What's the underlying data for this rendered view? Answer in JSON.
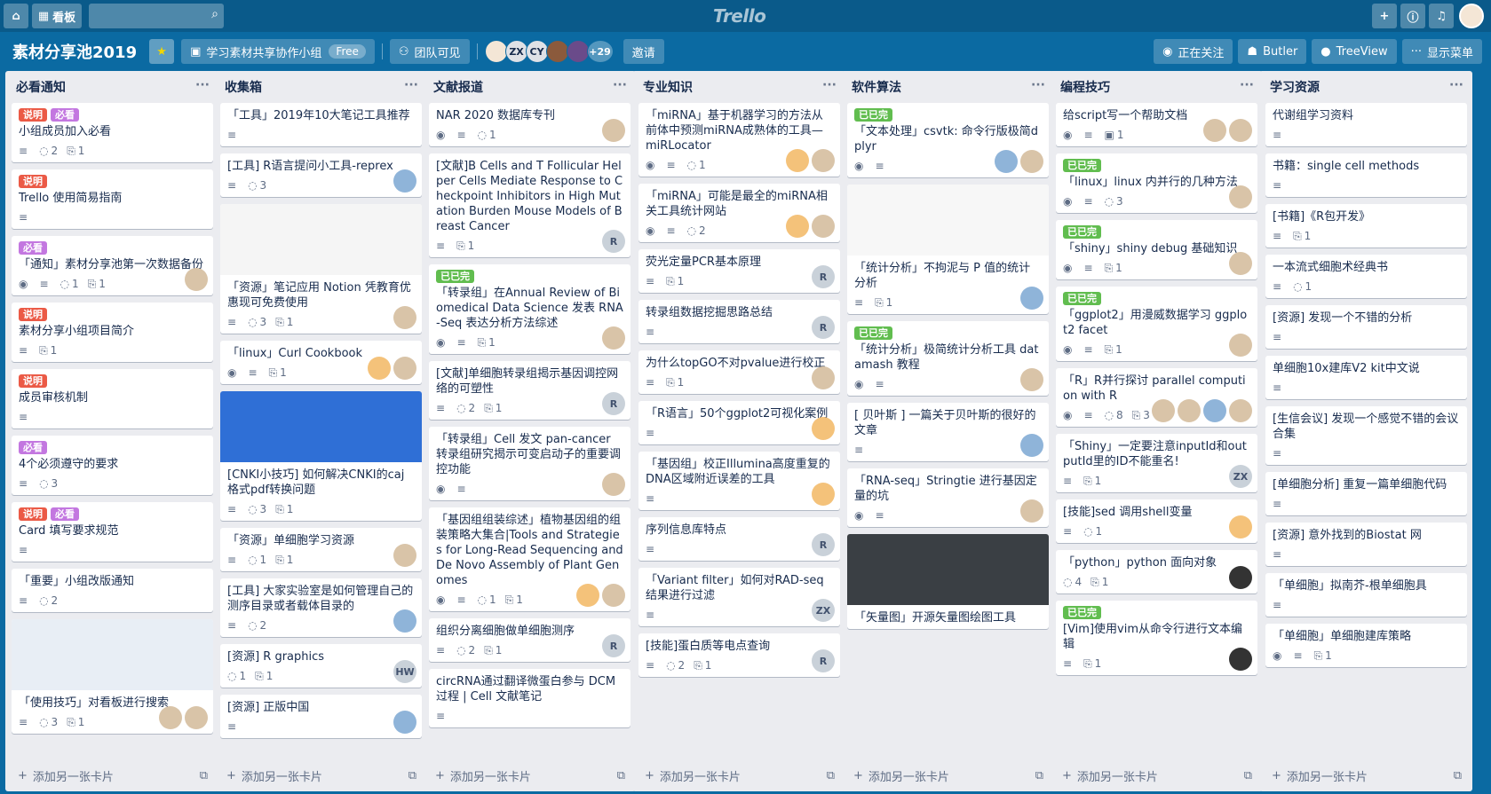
{
  "topbar": {
    "board_btn": "看板",
    "logo": "Trello",
    "search_placeholder": ""
  },
  "board": {
    "title": "素材分享池2019",
    "team": "学习素材共享协作小组",
    "team_badge": "Free",
    "visibility": "团队可见",
    "members": [
      "ZX",
      "CY"
    ],
    "members_more": "+29",
    "invite": "邀请",
    "watch": "正在关注",
    "butler": "Butler",
    "treeview": "TreeView",
    "show_menu": "显示菜单"
  },
  "add_card_label": "添加另一张卡片",
  "lists": [
    {
      "title": "必看通知",
      "cards": [
        {
          "labels": [
            {
              "t": "说明",
              "c": "red"
            },
            {
              "t": "必看",
              "c": "purple"
            }
          ],
          "title": "小组成员加入必看",
          "badges": [
            "desc",
            "c:2",
            "a:1"
          ]
        },
        {
          "labels": [
            {
              "t": "说明",
              "c": "red"
            }
          ],
          "title": "Trello 使用简易指南",
          "badges": [
            "desc"
          ]
        },
        {
          "labels": [
            {
              "t": "必看",
              "c": "purple"
            }
          ],
          "title": "「通知」素材分享池第一次数据备份",
          "badges": [
            "eye",
            "desc",
            "c:1",
            "a:1"
          ],
          "avs": [
            "face"
          ]
        },
        {
          "labels": [
            {
              "t": "说明",
              "c": "red"
            }
          ],
          "title": "素材分享小组项目简介",
          "badges": [
            "desc",
            "a:1"
          ]
        },
        {
          "labels": [
            {
              "t": "说明",
              "c": "red"
            }
          ],
          "title": "成员审核机制",
          "badges": [
            "desc"
          ]
        },
        {
          "labels": [
            {
              "t": "必看",
              "c": "purple"
            }
          ],
          "title": "4个必须遵守的要求",
          "badges": [
            "desc",
            "c:3"
          ]
        },
        {
          "labels": [
            {
              "t": "说明",
              "c": "red"
            },
            {
              "t": "必看",
              "c": "purple"
            }
          ],
          "title": "Card 填写要求规范",
          "badges": [
            "desc"
          ]
        },
        {
          "title": "「重要」小组改版通知",
          "badges": [
            "desc",
            "c:2"
          ]
        },
        {
          "cover": "#e8eef5",
          "title": "「使用技巧」对看板进行搜索",
          "badges": [
            "desc",
            "c:3",
            "a:1"
          ],
          "avs": [
            "face",
            "face"
          ]
        }
      ]
    },
    {
      "title": "收集箱",
      "cards": [
        {
          "title": "「工具」2019年10大笔记工具推荐",
          "badges": [
            "desc"
          ]
        },
        {
          "title": "[工具] R语言提问小工具-reprex",
          "badges": [
            "desc",
            "c:3"
          ],
          "avs": [
            "blue"
          ]
        },
        {
          "cover": "#f5f5f5",
          "title": "「资源」笔记应用 Notion 凭教育优惠现可免费使用",
          "badges": [
            "desc",
            "c:3",
            "a:1"
          ],
          "avs": [
            "face"
          ]
        },
        {
          "title": "「linux」Curl Cookbook",
          "badges": [
            "eye",
            "desc",
            "a:1"
          ],
          "avs": [
            "orange",
            "face"
          ]
        },
        {
          "cover": "#2f6fd6",
          "title": "[CNKI小技巧] 如何解决CNKI的caj格式pdf转换问题",
          "badges": [
            "desc",
            "c:3",
            "a:1"
          ]
        },
        {
          "title": "「资源」单细胞学习资源",
          "badges": [
            "desc",
            "c:1",
            "a:1"
          ],
          "avs": [
            "face"
          ]
        },
        {
          "title": "[工具] 大家实验室是如何管理自己的测序目录或者载体目录的",
          "badges": [
            "desc",
            "c:2"
          ],
          "avs": [
            "blue"
          ]
        },
        {
          "title": "[资源] R graphics",
          "badges": [
            "c:1",
            "a:1"
          ],
          "avs": [
            "HW"
          ]
        },
        {
          "title": "[资源] 正版中国",
          "badges": [
            "desc"
          ],
          "avs": [
            "blue"
          ]
        }
      ]
    },
    {
      "title": "文献报道",
      "cards": [
        {
          "title": "NAR 2020 数据库专刊",
          "badges": [
            "eye",
            "desc",
            "c:1"
          ],
          "avs": [
            "face"
          ]
        },
        {
          "title": "[文献]B Cells and T Follicular Helper Cells Mediate Response to Checkpoint Inhibitors in High Mutation Burden Mouse Models of Breast Cancer",
          "badges": [
            "desc",
            "a:1"
          ],
          "avs": [
            "R"
          ]
        },
        {
          "labels": [
            {
              "t": "已已完",
              "c": "green"
            }
          ],
          "title": "「转录组」在Annual Review of Biomedical Data Science 发表 RNA-Seq 表达分析方法综述",
          "badges": [
            "eye",
            "desc",
            "a:1"
          ],
          "avs": [
            "face"
          ]
        },
        {
          "title": "[文献]单细胞转录组揭示基因调控网络的可塑性",
          "badges": [
            "desc",
            "c:2",
            "a:1"
          ],
          "avs": [
            "R"
          ]
        },
        {
          "title": "「转录组」Cell 发文 pan-cancer 转录组研究揭示可变启动子的重要调控功能",
          "badges": [
            "eye",
            "desc"
          ],
          "avs": [
            "face"
          ]
        },
        {
          "title": "「基因组组装综述」植物基因组的组装策略大集合|Tools and Strategies for Long-Read Sequencing and De Novo Assembly of Plant Genomes",
          "badges": [
            "eye",
            "desc",
            "c:1",
            "a:1"
          ],
          "avs": [
            "orange",
            "face"
          ]
        },
        {
          "title": "组织分离细胞做单细胞测序",
          "badges": [
            "desc",
            "c:2",
            "a:1"
          ],
          "avs": [
            "R"
          ]
        },
        {
          "title": "circRNA通过翻译微蛋白参与 DCM过程 | Cell 文献笔记",
          "badges": [
            "desc"
          ]
        }
      ]
    },
    {
      "title": "专业知识",
      "cards": [
        {
          "title": "「miRNA」基于机器学习的方法从前体中预测miRNA成熟体的工具—miRLocator",
          "badges": [
            "eye",
            "desc",
            "c:1"
          ],
          "avs": [
            "orange",
            "face"
          ]
        },
        {
          "title": "「miRNA」可能是最全的miRNA相关工具统计网站",
          "badges": [
            "eye",
            "desc",
            "c:2"
          ],
          "avs": [
            "orange",
            "face"
          ]
        },
        {
          "title": "荧光定量PCR基本原理",
          "badges": [
            "desc",
            "a:1"
          ],
          "avs": [
            "R"
          ]
        },
        {
          "title": "转录组数据挖掘思路总结",
          "badges": [
            "desc"
          ],
          "avs": [
            "R"
          ]
        },
        {
          "title": "为什么topGO不对pvalue进行校正",
          "badges": [
            "desc",
            "a:1"
          ],
          "avs": [
            "face"
          ]
        },
        {
          "title": "「R语言」50个ggplot2可视化案例",
          "badges": [
            "desc"
          ],
          "avs": [
            "orange"
          ]
        },
        {
          "title": "「基因组」校正Illumina高度重复的DNA区域附近误差的工具",
          "badges": [
            "desc"
          ],
          "avs": [
            "orange"
          ]
        },
        {
          "title": "序列信息库特点",
          "badges": [
            "desc"
          ],
          "avs": [
            "R"
          ]
        },
        {
          "title": "「Variant filter」如何对RAD-seq结果进行过滤",
          "badges": [
            "desc"
          ],
          "avs": [
            "ZX"
          ]
        },
        {
          "title": "[技能]蛋白质等电点查询",
          "badges": [
            "desc",
            "c:2",
            "a:1"
          ],
          "avs": [
            "R"
          ]
        }
      ]
    },
    {
      "title": "软件算法",
      "cards": [
        {
          "labels": [
            {
              "t": "已已完",
              "c": "green"
            }
          ],
          "title": "「文本处理」csvtk: 命令行版极简dplyr",
          "badges": [
            "eye",
            "desc"
          ],
          "avs": [
            "blue",
            "face"
          ]
        },
        {
          "cover": "#f7f7f7",
          "title": "「统计分析」不拘泥与 P 值的统计分析",
          "badges": [
            "desc",
            "a:1"
          ],
          "avs": [
            "blue"
          ]
        },
        {
          "labels": [
            {
              "t": "已已完",
              "c": "green"
            }
          ],
          "title": "「统计分析」极简统计分析工具 datamash 教程",
          "badges": [
            "eye",
            "desc"
          ],
          "avs": [
            "face"
          ]
        },
        {
          "title": "[ 贝叶斯 ] 一篇关于贝叶斯的很好的文章",
          "badges": [
            "desc"
          ],
          "avs": [
            "blue"
          ]
        },
        {
          "title": "「RNA-seq」Stringtie 进行基因定量的坑",
          "badges": [
            "eye",
            "desc"
          ],
          "avs": [
            "face"
          ]
        },
        {
          "cover": "#3a3f44",
          "title": "「矢量图」开源矢量图绘图工具",
          "badges": []
        }
      ]
    },
    {
      "title": "编程技巧",
      "cards": [
        {
          "title": "给script写一个帮助文档",
          "badges": [
            "eye",
            "desc",
            "b:1"
          ],
          "avs": [
            "face",
            "face"
          ]
        },
        {
          "labels": [
            {
              "t": "已已完",
              "c": "green"
            }
          ],
          "title": "「linux」linux 内并行的几种方法",
          "badges": [
            "eye",
            "desc",
            "c:3"
          ],
          "avs": [
            "face"
          ]
        },
        {
          "labels": [
            {
              "t": "已已完",
              "c": "green"
            }
          ],
          "title": "「shiny」shiny debug 基础知识",
          "badges": [
            "eye",
            "desc",
            "a:1"
          ],
          "avs": [
            "face"
          ]
        },
        {
          "labels": [
            {
              "t": "已已完",
              "c": "green"
            }
          ],
          "title": "「ggplot2」用漫威数据学习 ggplot2 facet",
          "badges": [
            "eye",
            "desc",
            "a:1"
          ],
          "avs": [
            "face"
          ]
        },
        {
          "title": "「R」R并行探讨 parallel compution with R",
          "badges": [
            "eye",
            "desc",
            "c:8",
            "a:3"
          ],
          "avs": [
            "face",
            "face",
            "blue",
            "face"
          ]
        },
        {
          "title": "「Shiny」一定要注意inputId和outputId里的ID不能重名!",
          "badges": [
            "desc",
            "a:1"
          ],
          "avs": [
            "ZX"
          ]
        },
        {
          "title": "[技能]sed 调用shell变量",
          "badges": [
            "desc",
            "c:1"
          ],
          "avs": [
            "orange"
          ]
        },
        {
          "title": "「python」python 面向对象",
          "badges": [
            "c:4",
            "a:1"
          ],
          "avs": [
            "dark"
          ]
        },
        {
          "labels": [
            {
              "t": "已已完",
              "c": "green"
            }
          ],
          "title": "[Vim]使用vim从命令行进行文本编辑",
          "badges": [
            "desc",
            "a:1"
          ],
          "avs": [
            "dark"
          ]
        }
      ]
    },
    {
      "title": "学习资源",
      "cards": [
        {
          "title": "代谢组学习资料",
          "badges": [
            "desc"
          ]
        },
        {
          "title": "书籍：single cell methods",
          "badges": [
            "desc"
          ]
        },
        {
          "title": "[书籍]《R包开发》",
          "badges": [
            "desc",
            "a:1"
          ]
        },
        {
          "title": "一本流式细胞术经典书",
          "badges": [
            "desc",
            "c:1"
          ]
        },
        {
          "title": "[资源] 发现一个不错的分析",
          "badges": [
            "desc"
          ]
        },
        {
          "title": "单细胞10x建库V2 kit中文说",
          "badges": [
            "desc"
          ]
        },
        {
          "title": "[生信会议] 发现一个感觉不错的会议合集",
          "badges": [
            "desc"
          ]
        },
        {
          "title": "[单细胞分析] 重复一篇单细胞代码",
          "badges": [
            "desc"
          ]
        },
        {
          "title": "[资源] 意外找到的Biostat 网",
          "badges": [
            "desc"
          ]
        },
        {
          "title": "「单细胞」拟南芥-根单细胞具",
          "badges": [
            "desc"
          ]
        },
        {
          "title": "「单细胞」单细胞建库策略",
          "badges": [
            "eye",
            "desc",
            "a:1"
          ]
        }
      ]
    }
  ]
}
